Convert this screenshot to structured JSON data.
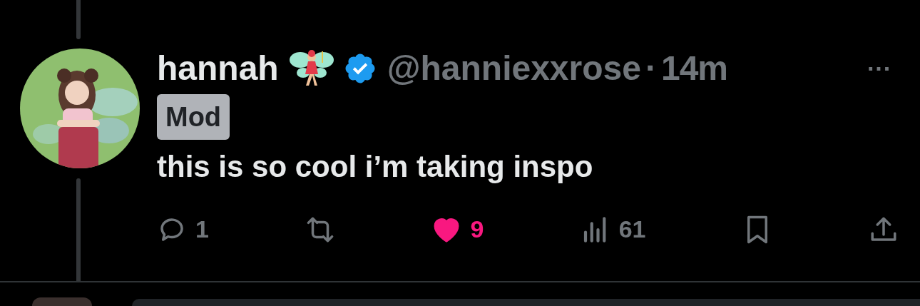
{
  "post": {
    "display_name": "hannah",
    "verified": true,
    "handle": "@hanniexxrose",
    "separator": "·",
    "time": "14m",
    "more": "···",
    "badge": "Mod",
    "text": "this is so cool i’m taking inspo",
    "actions": [
      {
        "kind": "reply",
        "count": "1",
        "selected": false
      },
      {
        "kind": "repost",
        "selected": false
      },
      {
        "kind": "like",
        "count": "9",
        "selected": true
      },
      {
        "kind": "views",
        "count": "61",
        "selected": false
      },
      {
        "kind": "bookmark",
        "selected": false
      },
      {
        "kind": "share",
        "selected": false
      }
    ]
  }
}
